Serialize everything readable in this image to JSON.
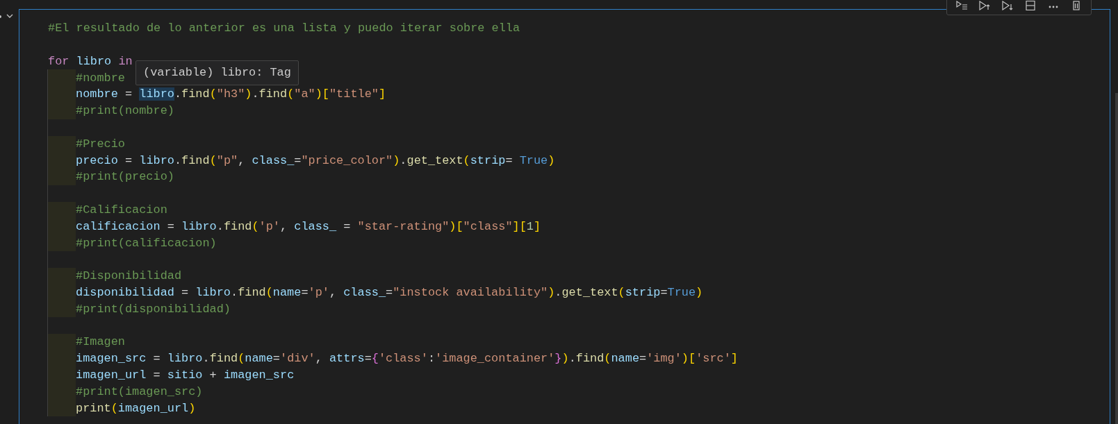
{
  "hover_tooltip": {
    "text": "(variable) libro: Tag"
  },
  "lines": [
    {
      "kind": "code",
      "tokens": [
        {
          "text": "#El resultado de lo anterior es una lista y puedo iterar sobre ella",
          "kind": "comment"
        }
      ]
    },
    {
      "kind": "blank"
    },
    {
      "kind": "code",
      "tokens": [
        {
          "text": "for ",
          "kind": "keyword"
        },
        {
          "text": "libro ",
          "kind": "variable"
        },
        {
          "text": "in",
          "kind": "keyword"
        }
      ],
      "children": [
        {
          "kind": "code",
          "tokens": [
            {
              "text": "#nombre",
              "kind": "comment"
            }
          ]
        },
        {
          "kind": "code",
          "tokens": [
            {
              "text": "nombre",
              "kind": "variable"
            },
            {
              "text": " = ",
              "kind": "plain"
            },
            {
              "text": "libro",
              "kind": "variable",
              "highlighted": true
            },
            {
              "text": ".",
              "kind": "plain"
            },
            {
              "text": "find",
              "kind": "function"
            },
            {
              "text": "(",
              "kind": "bracket"
            },
            {
              "text": "\"h3\"",
              "kind": "string"
            },
            {
              "text": ")",
              "kind": "bracket"
            },
            {
              "text": ".",
              "kind": "plain"
            },
            {
              "text": "find",
              "kind": "function"
            },
            {
              "text": "(",
              "kind": "bracket"
            },
            {
              "text": "\"a\"",
              "kind": "string"
            },
            {
              "text": ")",
              "kind": "bracket"
            },
            {
              "text": "[",
              "kind": "bracket"
            },
            {
              "text": "\"title\"",
              "kind": "string"
            },
            {
              "text": "]",
              "kind": "bracket"
            }
          ]
        },
        {
          "kind": "code",
          "tokens": [
            {
              "text": "#print(nombre)",
              "kind": "comment"
            }
          ]
        },
        {
          "kind": "blank"
        },
        {
          "kind": "code",
          "tokens": [
            {
              "text": "#Precio",
              "kind": "comment"
            }
          ]
        },
        {
          "kind": "code",
          "tokens": [
            {
              "text": "precio",
              "kind": "variable"
            },
            {
              "text": " = ",
              "kind": "plain"
            },
            {
              "text": "libro",
              "kind": "variable"
            },
            {
              "text": ".",
              "kind": "plain"
            },
            {
              "text": "find",
              "kind": "function"
            },
            {
              "text": "(",
              "kind": "bracket"
            },
            {
              "text": "\"p\"",
              "kind": "string"
            },
            {
              "text": ", ",
              "kind": "plain"
            },
            {
              "text": "class_",
              "kind": "variable"
            },
            {
              "text": "=",
              "kind": "plain"
            },
            {
              "text": "\"price_color\"",
              "kind": "string"
            },
            {
              "text": ")",
              "kind": "bracket"
            },
            {
              "text": ".",
              "kind": "plain"
            },
            {
              "text": "get_text",
              "kind": "function"
            },
            {
              "text": "(",
              "kind": "bracket"
            },
            {
              "text": "strip",
              "kind": "variable"
            },
            {
              "text": "= ",
              "kind": "plain"
            },
            {
              "text": "True",
              "kind": "constant"
            },
            {
              "text": ")",
              "kind": "bracket"
            }
          ]
        },
        {
          "kind": "code",
          "tokens": [
            {
              "text": "#print(precio)",
              "kind": "comment"
            }
          ]
        },
        {
          "kind": "blank"
        },
        {
          "kind": "code",
          "tokens": [
            {
              "text": "#Calificacion",
              "kind": "comment"
            }
          ]
        },
        {
          "kind": "code",
          "tokens": [
            {
              "text": "calificacion",
              "kind": "variable"
            },
            {
              "text": " = ",
              "kind": "plain"
            },
            {
              "text": "libro",
              "kind": "variable"
            },
            {
              "text": ".",
              "kind": "plain"
            },
            {
              "text": "find",
              "kind": "function"
            },
            {
              "text": "(",
              "kind": "bracket"
            },
            {
              "text": "'p'",
              "kind": "string"
            },
            {
              "text": ", ",
              "kind": "plain"
            },
            {
              "text": "class_",
              "kind": "variable"
            },
            {
              "text": " = ",
              "kind": "plain"
            },
            {
              "text": "\"star-rating\"",
              "kind": "string"
            },
            {
              "text": ")",
              "kind": "bracket"
            },
            {
              "text": "[",
              "kind": "bracket"
            },
            {
              "text": "\"class\"",
              "kind": "string"
            },
            {
              "text": "]",
              "kind": "bracket"
            },
            {
              "text": "[",
              "kind": "bracket"
            },
            {
              "text": "1",
              "kind": "number"
            },
            {
              "text": "]",
              "kind": "bracket"
            }
          ]
        },
        {
          "kind": "code",
          "tokens": [
            {
              "text": "#print(calificacion)",
              "kind": "comment"
            }
          ]
        },
        {
          "kind": "blank"
        },
        {
          "kind": "code",
          "tokens": [
            {
              "text": "#Disponibilidad",
              "kind": "comment"
            }
          ]
        },
        {
          "kind": "code",
          "tokens": [
            {
              "text": "disponibilidad",
              "kind": "variable"
            },
            {
              "text": " = ",
              "kind": "plain"
            },
            {
              "text": "libro",
              "kind": "variable"
            },
            {
              "text": ".",
              "kind": "plain"
            },
            {
              "text": "find",
              "kind": "function"
            },
            {
              "text": "(",
              "kind": "bracket"
            },
            {
              "text": "name",
              "kind": "variable"
            },
            {
              "text": "=",
              "kind": "plain"
            },
            {
              "text": "'p'",
              "kind": "string"
            },
            {
              "text": ", ",
              "kind": "plain"
            },
            {
              "text": "class_",
              "kind": "variable"
            },
            {
              "text": "=",
              "kind": "plain"
            },
            {
              "text": "\"instock availability\"",
              "kind": "string"
            },
            {
              "text": ")",
              "kind": "bracket"
            },
            {
              "text": ".",
              "kind": "plain"
            },
            {
              "text": "get_text",
              "kind": "function"
            },
            {
              "text": "(",
              "kind": "bracket"
            },
            {
              "text": "strip",
              "kind": "variable"
            },
            {
              "text": "=",
              "kind": "plain"
            },
            {
              "text": "True",
              "kind": "constant"
            },
            {
              "text": ")",
              "kind": "bracket"
            }
          ]
        },
        {
          "kind": "code",
          "tokens": [
            {
              "text": "#print(disponibilidad)",
              "kind": "comment"
            }
          ]
        },
        {
          "kind": "blank"
        },
        {
          "kind": "code",
          "tokens": [
            {
              "text": "#Imagen",
              "kind": "comment"
            }
          ]
        },
        {
          "kind": "code",
          "tokens": [
            {
              "text": "imagen_src",
              "kind": "variable"
            },
            {
              "text": " = ",
              "kind": "plain"
            },
            {
              "text": "libro",
              "kind": "variable"
            },
            {
              "text": ".",
              "kind": "plain"
            },
            {
              "text": "find",
              "kind": "function"
            },
            {
              "text": "(",
              "kind": "bracket"
            },
            {
              "text": "name",
              "kind": "variable"
            },
            {
              "text": "=",
              "kind": "plain"
            },
            {
              "text": "'div'",
              "kind": "string"
            },
            {
              "text": ", ",
              "kind": "plain"
            },
            {
              "text": "attrs",
              "kind": "variable"
            },
            {
              "text": "=",
              "kind": "plain"
            },
            {
              "text": "{",
              "kind": "brace"
            },
            {
              "text": "'class'",
              "kind": "string"
            },
            {
              "text": ":",
              "kind": "plain"
            },
            {
              "text": "'image_container'",
              "kind": "string"
            },
            {
              "text": "}",
              "kind": "brace"
            },
            {
              "text": ")",
              "kind": "bracket"
            },
            {
              "text": ".",
              "kind": "plain"
            },
            {
              "text": "find",
              "kind": "function"
            },
            {
              "text": "(",
              "kind": "bracket"
            },
            {
              "text": "name",
              "kind": "variable"
            },
            {
              "text": "=",
              "kind": "plain"
            },
            {
              "text": "'img'",
              "kind": "string"
            },
            {
              "text": ")",
              "kind": "bracket"
            },
            {
              "text": "[",
              "kind": "bracket"
            },
            {
              "text": "'src'",
              "kind": "string"
            },
            {
              "text": "]",
              "kind": "bracket"
            }
          ]
        },
        {
          "kind": "code",
          "tokens": [
            {
              "text": "imagen_url",
              "kind": "variable"
            },
            {
              "text": " = ",
              "kind": "plain"
            },
            {
              "text": "sitio",
              "kind": "variable"
            },
            {
              "text": " + ",
              "kind": "plain"
            },
            {
              "text": "imagen_src",
              "kind": "variable"
            }
          ]
        },
        {
          "kind": "code",
          "tokens": [
            {
              "text": "#print(imagen_src)",
              "kind": "comment"
            }
          ]
        },
        {
          "kind": "code",
          "tokens": [
            {
              "text": "print",
              "kind": "function"
            },
            {
              "text": "(",
              "kind": "bracket"
            },
            {
              "text": "imagen_url",
              "kind": "variable"
            },
            {
              "text": ")",
              "kind": "bracket"
            }
          ]
        }
      ]
    }
  ]
}
